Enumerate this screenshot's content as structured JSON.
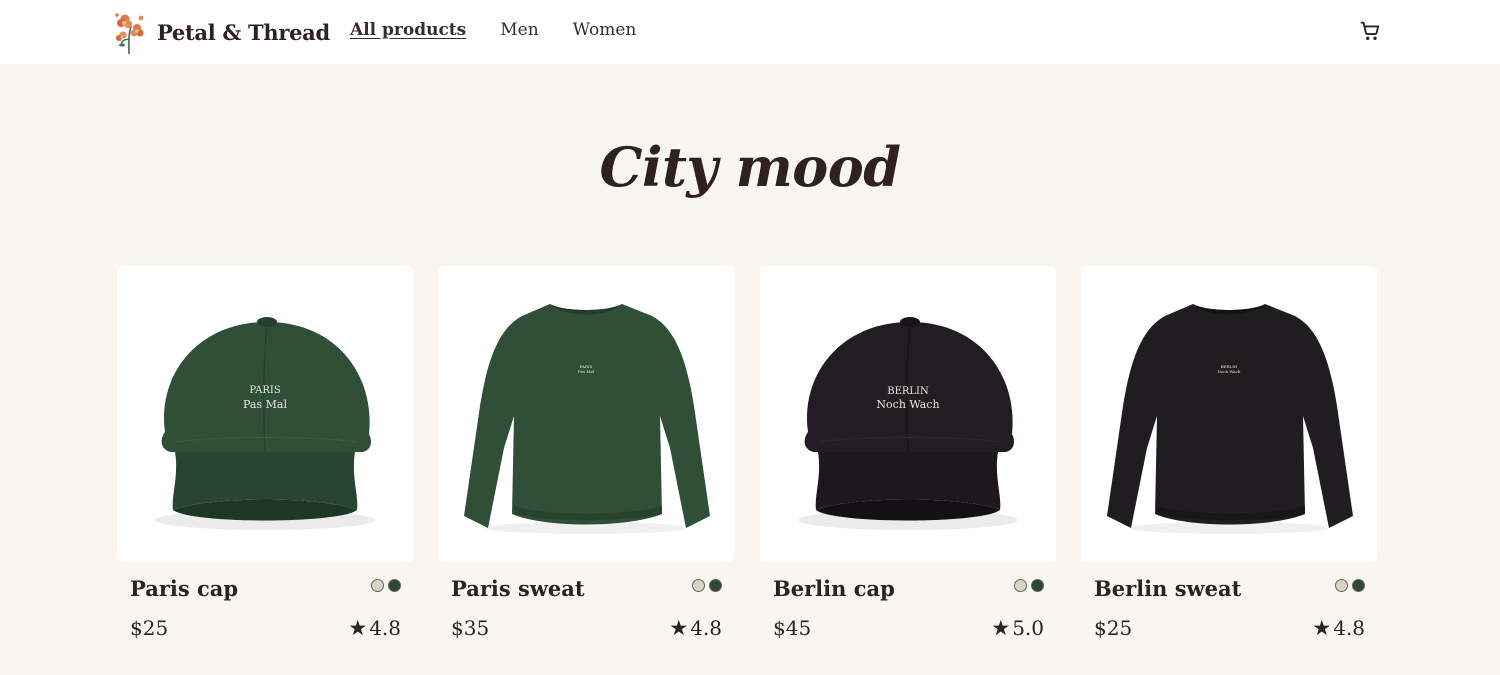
{
  "brand": {
    "name": "Petal & Thread"
  },
  "nav": {
    "items": [
      {
        "label": "All products",
        "active": true
      },
      {
        "label": "Men",
        "active": false
      },
      {
        "label": "Women",
        "active": false
      }
    ]
  },
  "icons": {
    "cart": "shopping-cart-icon",
    "star": "star-icon",
    "logo": "flower-logo-icon"
  },
  "page": {
    "title": "City mood"
  },
  "colors": {
    "background": "#f9f6f1",
    "text": "#2e2120",
    "swatch_light": "#d8d4c2",
    "swatch_green": "#2b4a34",
    "green_product": "#2f4f37",
    "black_product": "#221d22"
  },
  "products": [
    {
      "name": "Paris cap",
      "price": "$25",
      "rating": "4.8",
      "print_line1": "PARIS",
      "print_line2": "Pas Mal"
    },
    {
      "name": "Paris sweat",
      "price": "$35",
      "rating": "4.8",
      "print_line1": "PARIS",
      "print_line2": "Pas Mal"
    },
    {
      "name": "Berlin cap",
      "price": "$45",
      "rating": "5.0",
      "print_line1": "BERLIN",
      "print_line2": "Noch Wach"
    },
    {
      "name": "Berlin sweat",
      "price": "$25",
      "rating": "4.8",
      "print_line1": "BERLIN",
      "print_line2": "Noch Wach"
    }
  ],
  "rating_star": "★"
}
